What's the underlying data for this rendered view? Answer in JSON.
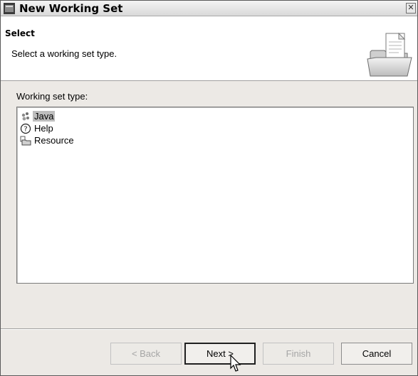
{
  "window": {
    "title": "New Working Set",
    "close_glyph": "✕"
  },
  "banner": {
    "title": "Select",
    "description": "Select a working set type.",
    "icon": "folder-with-document-icon"
  },
  "section": {
    "label": "Working set type:"
  },
  "working_set_types": [
    {
      "label": "Java",
      "icon": "java-icon",
      "selected": true
    },
    {
      "label": "Help",
      "icon": "help-icon",
      "selected": false
    },
    {
      "label": "Resource",
      "icon": "resource-icon",
      "selected": false
    }
  ],
  "buttons": {
    "back": "< Back",
    "next": "Next >",
    "finish": "Finish",
    "cancel": "Cancel"
  },
  "colors": {
    "selection": "#bdbdbd",
    "dialog_bg": "#ece9e5",
    "disabled_text": "#a5a5a5"
  }
}
